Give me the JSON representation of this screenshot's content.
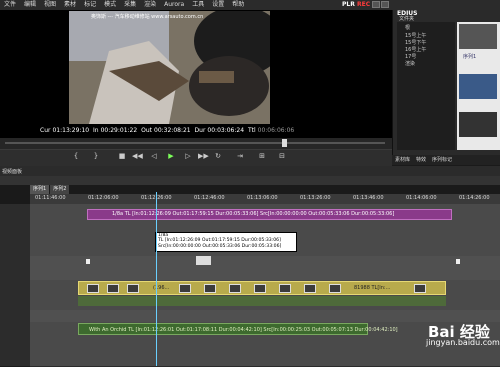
{
  "menu": {
    "items": [
      "文件",
      "编辑",
      "视图",
      "素材",
      "标记",
      "模式",
      "采集",
      "渲染",
      "Aurora",
      "工具",
      "设置",
      "帮助"
    ],
    "plr": "PLR",
    "rec": "REC",
    "app": "EDIUS"
  },
  "player": {
    "video_caption": "奥饰斯 --- 汽车移动维修站  www.arsauto.com.cn",
    "cur_label": "Cur",
    "cur_tc": "01:13:29:10",
    "in_label": "In",
    "in_tc": "00:29:01:22",
    "out_label": "Out",
    "out_tc": "00:32:08:21",
    "dur_label": "Dur",
    "dur_tc": "00:03:06:24",
    "ttl_label": "Ttl",
    "ttl_tc": "00:06:06:06"
  },
  "bin": {
    "title": "文件夹",
    "items": [
      "根",
      "15号上午",
      "15号下午",
      "16号上午",
      "17号",
      "渲染"
    ],
    "tabs": [
      "素材库",
      "特效",
      "序列标记"
    ],
    "side_label": "序列1"
  },
  "timeline": {
    "panel_title": "视频面板",
    "seq_tabs": [
      "序列1",
      "序列2"
    ],
    "ruler": [
      "01:11:46:00",
      "01:12:06:00",
      "01:12:26:00",
      "01:12:46:00",
      "01:13:06:00",
      "01:13:26:00",
      "01:13:46:00",
      "01:14:06:00",
      "01:14:26:00"
    ],
    "v1_clip": "1/8a  TL [In:01:12:26:09 Out:01:17:59:15 Dur:00:05:33:06]  Src[In:00:00:00:00 Out:00:05:33:06 Dur:00:05:33:06]",
    "tooltip_lines": [
      "1/8a",
      "TL [In:01:12:26:09 Out:01:17:59:15 Dur:00:05:33:06]",
      "Src[In:00:00:00:00 Out:00:05:33:06 Dur:00:05:33:06]"
    ],
    "yellow_clip_label": "(196...",
    "yellow_clip_label2": "81988  TL[In:...",
    "green_clip": "With An Orchid  TL [In:01:12:26:01 Out:01:17:08:11 Dur:00:04:42:10]   Src[In:00:00:25:03 Out:00:05:07:13 Dur:00:04:42:10]"
  },
  "watermark": {
    "brand": "Bai 经验",
    "url": "jingyan.baidu.com"
  },
  "colors": {
    "plr_color": "#ffffff",
    "rec_color": "#ff3b3b",
    "purple_clip": "#8a3a8a",
    "yellow_clip": "#b8aa4c",
    "green_clip": "#3d6a2e",
    "cursor": "#6ad0ff"
  },
  "icons": {
    "transport": [
      "set-in-icon",
      "set-out-icon",
      "stop-icon",
      "rewind-icon",
      "step-back-icon",
      "play-icon",
      "step-forward-icon",
      "fast-forward-icon",
      "loop-icon",
      "play-in-out-icon",
      "insert-icon",
      "overwrite-icon"
    ]
  }
}
